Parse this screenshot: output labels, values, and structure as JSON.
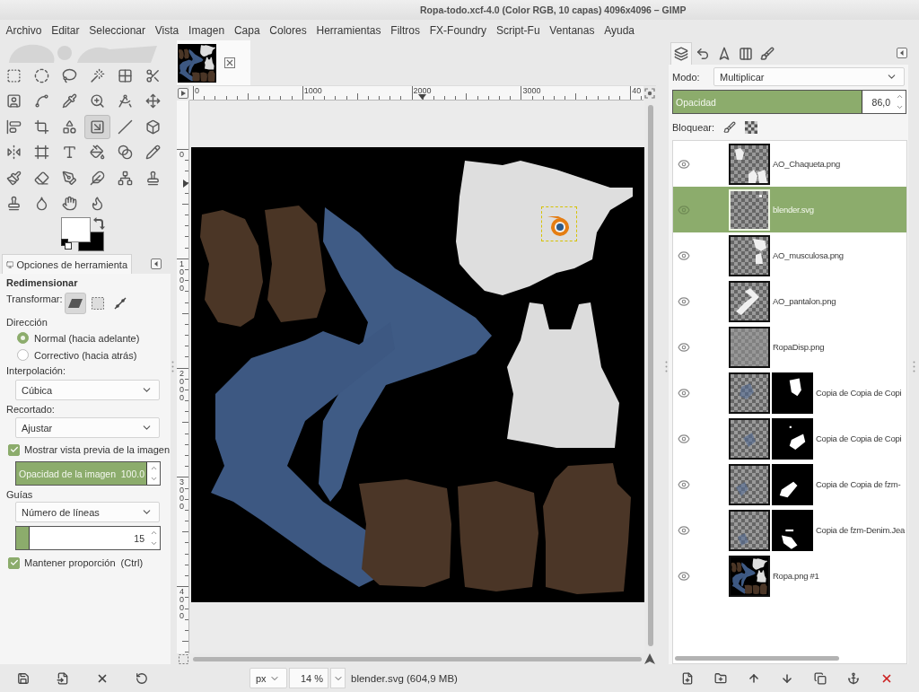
{
  "window": {
    "title": "Ropa-todo.xcf-4.0 (Color RGB, 10 capas) 4096x4096 – GIMP"
  },
  "menu": [
    "Archivo",
    "Editar",
    "Seleccionar",
    "Vista",
    "Imagen",
    "Capa",
    "Colores",
    "Herramientas",
    "Filtros",
    "FX-Foundry",
    "Script-Fu",
    "Ventanas",
    "Ayuda"
  ],
  "toolbox": {
    "tools": [
      {
        "selected": false
      },
      {
        "selected": false
      },
      {
        "selected": false
      },
      {
        "selected": false
      },
      {
        "selected": false
      },
      {
        "selected": false
      },
      {
        "selected": false
      },
      {
        "selected": false
      },
      {
        "selected": false
      },
      {
        "selected": false
      },
      {
        "selected": false
      },
      {
        "selected": false
      },
      {
        "selected": false
      },
      {
        "selected": false
      },
      {
        "selected": false
      },
      {
        "selected": true
      },
      {
        "selected": false
      },
      {
        "selected": false
      },
      {
        "selected": false
      },
      {
        "selected": false
      },
      {
        "selected": false
      },
      {
        "selected": false
      },
      {
        "selected": false
      },
      {
        "selected": false
      },
      {
        "selected": false
      },
      {
        "selected": false
      },
      {
        "selected": false
      },
      {
        "selected": false
      },
      {
        "selected": false
      },
      {
        "selected": false
      },
      {
        "selected": false
      },
      {
        "selected": false
      },
      {
        "selected": false
      },
      {
        "selected": false
      }
    ]
  },
  "tool_options": {
    "tab": "Opciones de herramienta",
    "tool": "Redimensionar",
    "transform": {
      "label": "Transformar:",
      "modes": [
        {
          "selected": true
        },
        {
          "selected": false
        },
        {
          "selected": false
        }
      ]
    },
    "direction": {
      "label": "Dirección",
      "options": [
        {
          "label": "Normal (hacia adelante)",
          "selected": true
        },
        {
          "label": "Correctivo (hacia atrás)",
          "selected": false
        }
      ]
    },
    "interpolation": {
      "label": "Interpolación:",
      "value": "Cúbica"
    },
    "clipping": {
      "label": "Recortado:",
      "value": "Ajustar"
    },
    "show_preview": {
      "label": "Mostrar vista previa de la imagen",
      "checked": true
    },
    "image_opacity": {
      "label": "Opacidad de la imagen",
      "reading": "100.0",
      "level": 1
    },
    "guides": {
      "label": "Guías",
      "value": "Número de líneas",
      "count": {
        "reading": "15",
        "level": 0.1
      }
    },
    "keep_aspect": {
      "label": "Mantener proporción  (Ctrl)",
      "checked": true
    }
  },
  "image": {
    "rulers": {
      "horizontal": [
        "0",
        "1000",
        "2000",
        "3000",
        "40"
      ],
      "vertical": [
        "0",
        "1000",
        "2000",
        "3000",
        "4000"
      ]
    }
  },
  "status_bar": {
    "unit": "px",
    "zoom": "14 %",
    "message": "blender.svg (604,9 MB)"
  },
  "layers_panel": {
    "tabs": [
      {
        "selected": true
      },
      {
        "selected": false
      },
      {
        "selected": false
      },
      {
        "selected": false
      },
      {
        "selected": false
      }
    ],
    "mode": {
      "label": "Modo:",
      "value": "Multiplicar"
    },
    "opacity": {
      "label": "Opacidad",
      "reading": "86,0",
      "level": 0.86
    },
    "lock": {
      "label": "Bloquear:"
    },
    "layers": [
      {
        "name": "AO_Chaqueta.png",
        "visible": true,
        "alpha": true,
        "mask": false,
        "selected": false
      },
      {
        "name": "blender.svg",
        "visible": true,
        "alpha": true,
        "mask": false,
        "selected": true
      },
      {
        "name": "AO_musculosa.png",
        "visible": true,
        "alpha": true,
        "mask": false,
        "selected": false
      },
      {
        "name": "AO_pantalon.png",
        "visible": true,
        "alpha": true,
        "mask": false,
        "selected": false
      },
      {
        "name": "RopaDisp.png",
        "visible": true,
        "alpha": true,
        "mask": false,
        "selected": false
      },
      {
        "name": "Copia de Copia de Copi",
        "visible": true,
        "alpha": true,
        "mask": true,
        "selected": false
      },
      {
        "name": "Copia de Copia de Copi",
        "visible": true,
        "alpha": true,
        "mask": true,
        "selected": false
      },
      {
        "name": "Copia de Copia de fzm-",
        "visible": true,
        "alpha": true,
        "mask": true,
        "selected": false
      },
      {
        "name": "Copia de fzm-Denim.Jea",
        "visible": true,
        "alpha": true,
        "mask": true,
        "selected": false
      },
      {
        "name": "Ropa.png #1",
        "visible": true,
        "alpha": false,
        "mask": false,
        "selected": false
      }
    ]
  }
}
